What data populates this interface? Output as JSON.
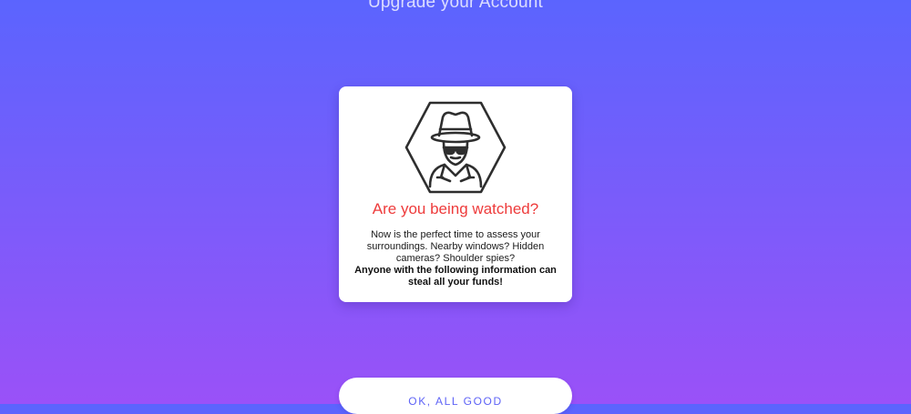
{
  "header": {
    "title": "Upgrade your Account"
  },
  "warning_card": {
    "icon": "spy-icon",
    "heading": "Are you being watched?",
    "heading_color": "#ee3b3b",
    "body": "Now is the perfect time to assess your surroundings. Nearby windows? Hidden cameras? Shoulder spies?",
    "warning": "Anyone with the following information can steal all your funds!"
  },
  "actions": {
    "confirm_label": "OK, ALL GOOD"
  },
  "colors": {
    "gradient_top": "#5b64fe",
    "gradient_bottom": "#9a51f8",
    "button_text": "#5e63f6"
  }
}
